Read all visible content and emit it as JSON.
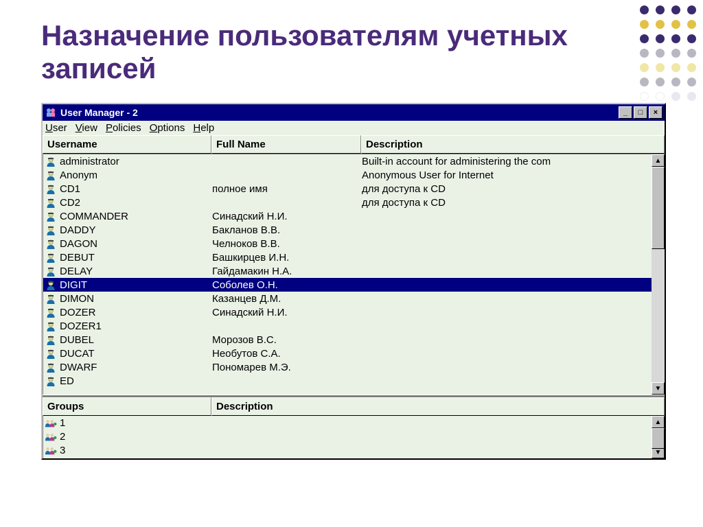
{
  "slide_title": "Назначение пользователям учетных записей",
  "window": {
    "title": "User Manager - 2",
    "menubar": {
      "user": {
        "hotkey": "U",
        "rest": "ser"
      },
      "view": {
        "hotkey": "V",
        "rest": "iew"
      },
      "policies": {
        "hotkey": "P",
        "rest": "olicies"
      },
      "options": {
        "hotkey": "O",
        "rest": "ptions"
      },
      "help": {
        "hotkey": "H",
        "rest": "elp"
      }
    },
    "columns": {
      "username": "Username",
      "fullname": "Full Name",
      "description": "Description"
    },
    "users": [
      {
        "username": "administrator",
        "fullname": "",
        "description": "Built-in account for administering the com"
      },
      {
        "username": "Anonym",
        "fullname": "",
        "description": "Anonymous User for Internet"
      },
      {
        "username": "CD1",
        "fullname": "полное имя",
        "description": "для доступа к CD"
      },
      {
        "username": "CD2",
        "fullname": "",
        "description": "для доступа к CD"
      },
      {
        "username": "COMMANDER",
        "fullname": "Синадский Н.И.",
        "description": ""
      },
      {
        "username": "DADDY",
        "fullname": "Бакланов В.В.",
        "description": ""
      },
      {
        "username": "DAGON",
        "fullname": "Челноков В.В.",
        "description": ""
      },
      {
        "username": "DEBUT",
        "fullname": "Башкирцев И.Н.",
        "description": ""
      },
      {
        "username": "DELAY",
        "fullname": "Гайдамакин Н.А.",
        "description": ""
      },
      {
        "username": "DIGIT",
        "fullname": "Соболев О.Н.",
        "description": "",
        "selected": true
      },
      {
        "username": "DIMON",
        "fullname": "Казанцев Д.М.",
        "description": ""
      },
      {
        "username": "DOZER",
        "fullname": "Синадский Н.И.",
        "description": ""
      },
      {
        "username": "DOZER1",
        "fullname": "",
        "description": ""
      },
      {
        "username": "DUBEL",
        "fullname": "Морозов В.С.",
        "description": ""
      },
      {
        "username": "DUCAT",
        "fullname": "Необутов С.А.",
        "description": ""
      },
      {
        "username": "DWARF",
        "fullname": "Пономарев М.Э.",
        "description": ""
      },
      {
        "username": "ED",
        "fullname": "",
        "description": ""
      }
    ],
    "groups_columns": {
      "groups": "Groups",
      "description": "Description"
    },
    "groups": [
      {
        "name": "1"
      },
      {
        "name": "2"
      },
      {
        "name": "3"
      }
    ]
  }
}
